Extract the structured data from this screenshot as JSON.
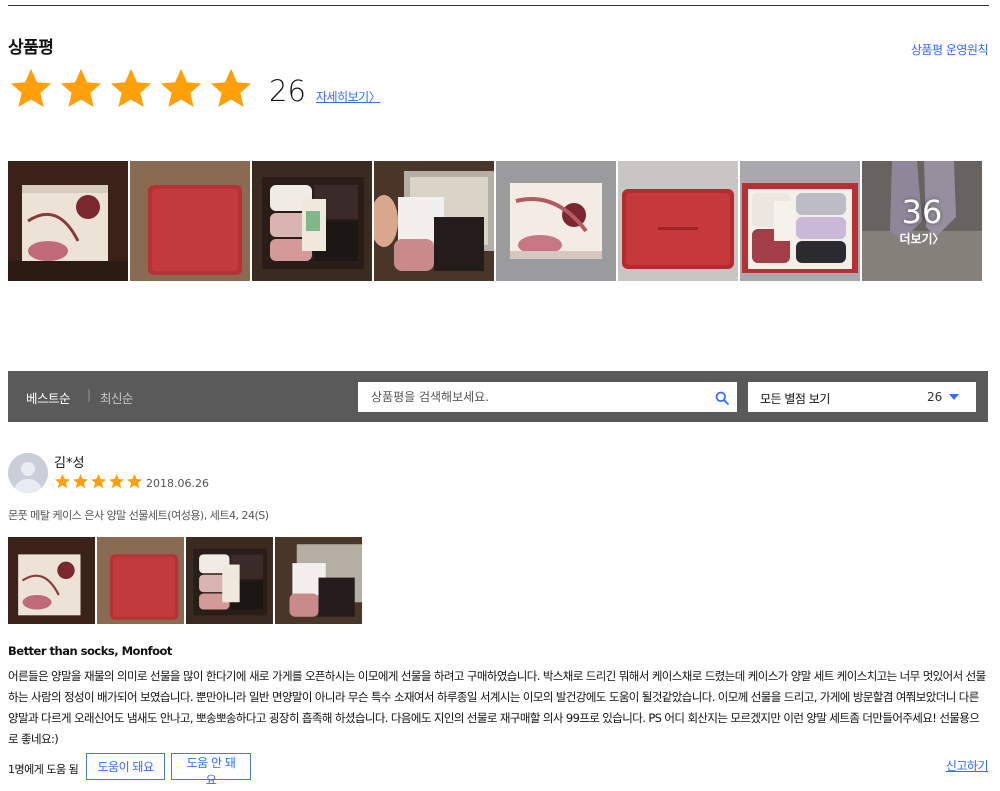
{
  "header": {
    "title": "상품평",
    "policy_link": "상품평 운영원칙"
  },
  "summary": {
    "rating": 5,
    "rating_max": 5,
    "count": "26",
    "detail_link": "자세히보기〉"
  },
  "gallery": {
    "more_count": "36",
    "more_label": "더보기〉"
  },
  "filter": {
    "sort_best": "베스트순",
    "separator": "|",
    "sort_recent": "최신순",
    "search_placeholder": "상품평을 검색해보세요.",
    "star_filter_label": "모든 별점 보기",
    "star_filter_count": "26"
  },
  "review": {
    "author": "김*성",
    "rating": 5,
    "date": "2018.06.26",
    "product": "몬풋 메탈 케이스 은사 양말 선물세트(여성용), 세트4, 24(S)",
    "headline": "Better than socks, Monfoot",
    "body": "어른들은 양말을 재물의 의미로 선물을 많이 한다기에 새로 가게를 오픈하시는 이모에게 선물을 하려고 구매하였습니다. 박스채로 드리긴 뭐해서 케이스채로 드렸는데 케이스가 양말 세트 케이스치고는 너무 멋있어서 선물하는 사람의 정성이 배가되어 보였습니다. 뿐만아니라 일반 면양말이 아니라 무슨 특수 소재여서 하루종일 서계시는 이모의 발건강에도 도움이 될것같았습니다. 이모께 선물을 드리고, 가게에 방문할겸 여쭤보았더니 다른 양말과 다르게 오래신어도 냄새도 안나고, 뽀송뽀송하다고 굉장히 흡족해 하셨습니다. 다음에도 지인의 선물로 재구매할 의사 99프로 있습니다. PS 어디 회산지는 모르겠지만 이런 양말 세트좀 더만들어주세요! 선물용으로 좋네요:)",
    "helpful_count": "1명에게 도움 됨",
    "helpful_yes": "도움이 돼요",
    "helpful_no": "도움 안 돼요",
    "report": "신고하기"
  },
  "colors": {
    "star": "#ff9f0a",
    "link": "#346aff",
    "filterbar": "#5a5a5a"
  }
}
